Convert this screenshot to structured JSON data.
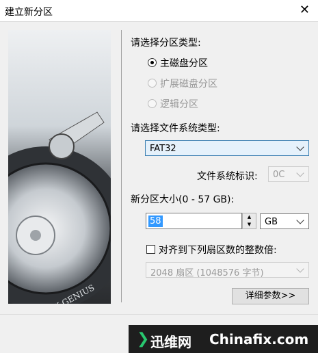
{
  "window": {
    "title": "建立新分区",
    "close_glyph": "✕"
  },
  "image_panel": {
    "brand_text": "DISK GENIUS"
  },
  "partition_type": {
    "heading": "请选择分区类型:",
    "options": [
      {
        "label": "主磁盘分区",
        "selected": true,
        "enabled": true
      },
      {
        "label": "扩展磁盘分区",
        "selected": false,
        "enabled": false
      },
      {
        "label": "逻辑分区",
        "selected": false,
        "enabled": false
      }
    ]
  },
  "filesystem": {
    "heading": "请选择文件系统类型:",
    "selected": "FAT32",
    "id_label": "文件系统标识:",
    "id_value": "0C"
  },
  "size": {
    "heading": "新分区大小(0 - 57 GB):",
    "value": "58",
    "unit": "GB"
  },
  "align": {
    "label": "对齐到下列扇区数的整数倍:",
    "checked": false,
    "value": "2048 扇区 (1048576 字节)"
  },
  "buttons": {
    "details": "详细参数>>"
  },
  "watermark": {
    "text1": "迅维网",
    "text2": "Chinafix.com"
  },
  "colors": {
    "select_highlight": "#e5f1fb",
    "selection": "#3399ff",
    "watermark_bg": "#1e1e1e"
  }
}
